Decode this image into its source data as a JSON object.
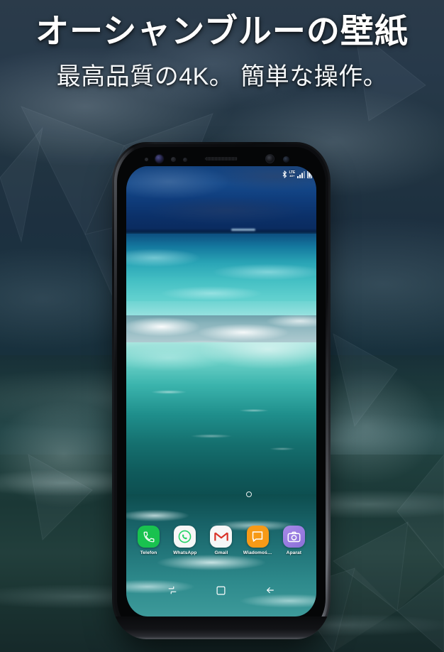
{
  "promo": {
    "title": "オーシャンブルーの壁紙",
    "subtitle": "最高品質の4K。 簡単な操作。"
  },
  "colors": {
    "title_color": "#ffffff",
    "subtitle_color": "#f4f7f9",
    "sky_blue": "#154a8c",
    "ocean_turquoise": "#45c0c4",
    "wave_teal": "#15706f",
    "foam_white": "#ffffff"
  },
  "phone": {
    "status_bar": {
      "bluetooth_icon": "bluetooth-icon",
      "network_label": "LTE",
      "network_sublabel": "4G+",
      "signal_icon": "signal-bars-icon",
      "battery_icon": "battery-icon"
    },
    "wallpaper": {
      "name": "ocean-blue-wave-wallpaper"
    },
    "page_indicator": {
      "dots": 1,
      "active": 0
    },
    "dock": [
      {
        "label": "Telefon",
        "icon": "phone-icon",
        "bg": "#19c24f",
        "fg": "#ffffff"
      },
      {
        "label": "WhatsApp",
        "icon": "whatsapp-icon",
        "bg": "#f7f7f7",
        "fg": "#25d366"
      },
      {
        "label": "Gmail",
        "icon": "gmail-icon",
        "bg": "#f7f7f7",
        "fg": "#d93025"
      },
      {
        "label": "Wiadomoś…",
        "icon": "message-icon",
        "bg": "#f79a17",
        "fg": "#ffffff"
      },
      {
        "label": "Aparat",
        "icon": "camera-icon",
        "bg": "#9b7fe0",
        "fg": "#ffffff"
      }
    ],
    "navbar": [
      {
        "name": "recents-button",
        "icon": "recents-icon"
      },
      {
        "name": "home-button",
        "icon": "home-square-icon"
      },
      {
        "name": "back-button",
        "icon": "back-arrow-icon"
      }
    ],
    "hardware": {
      "iris_scanner": "iris-scanner-sensor",
      "proximity_sensor": "proximity-sensor",
      "earpiece": "earpiece-speaker",
      "front_camera": "front-camera",
      "light_sensor": "light-sensor"
    }
  }
}
